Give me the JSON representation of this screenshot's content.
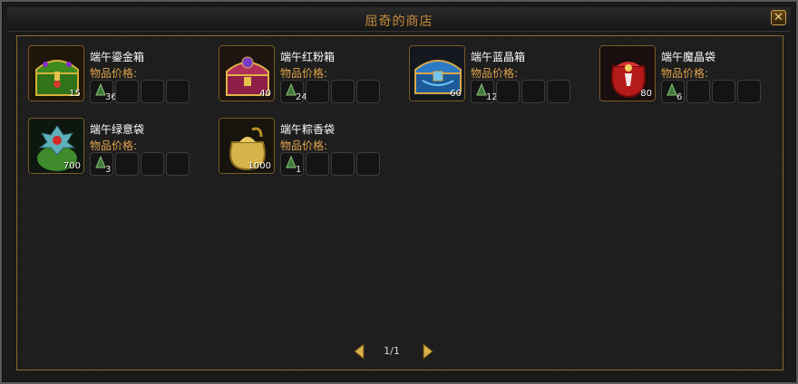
{
  "window": {
    "title": "屈奇的商店"
  },
  "shop": {
    "price_label": "物品价格:",
    "items": [
      {
        "name": "端午鎏金箱",
        "qty": "15",
        "cost": "36"
      },
      {
        "name": "端午红粉箱",
        "qty": "40",
        "cost": "24"
      },
      {
        "name": "端午蓝晶箱",
        "qty": "60",
        "cost": "12"
      },
      {
        "name": "端午魔晶袋",
        "qty": "80",
        "cost": "6"
      },
      {
        "name": "端午绿意袋",
        "qty": "700",
        "cost": "3"
      },
      {
        "name": "端午粽香袋",
        "qty": "1000",
        "cost": "1"
      }
    ]
  },
  "pager": {
    "text": "1/1"
  },
  "colors": {
    "title": "#c58a3a",
    "price_label": "#e2a44c",
    "border_gold": "#8a6a2e"
  }
}
